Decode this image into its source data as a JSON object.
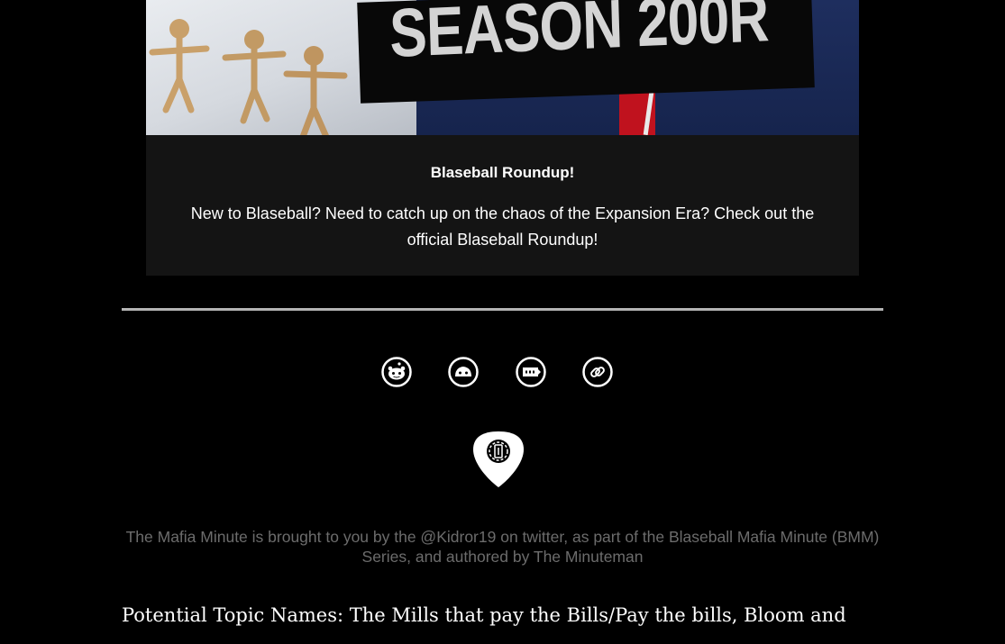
{
  "hero": {
    "headline": "SEASON 200R"
  },
  "card": {
    "title": "Blaseball Roundup!",
    "body": "New to Blaseball? Need to catch up on the chaos of the Expansion Era? Check out the official Blaseball Roundup!"
  },
  "social": {
    "icons": [
      "reddit-icon",
      "discord-icon",
      "twitch-icon",
      "link-icon"
    ]
  },
  "footer": {
    "credit": "The Mafia Minute is brought to you by the @Kidror19 on twitter, as part of the Blaseball Mafia Minute (BMM) Series, and authored by The Minuteman",
    "logo_icon": "guitar-pick-logo-icon"
  },
  "content": {
    "topics_line": "Potential Topic Names: The Mills that pay the Bills/Pay the bills, Bloom and"
  },
  "colors": {
    "page_background": "#000000",
    "card_background": "#141414",
    "divider": "#b4b4b4",
    "footer_text": "#6c6c6c"
  }
}
